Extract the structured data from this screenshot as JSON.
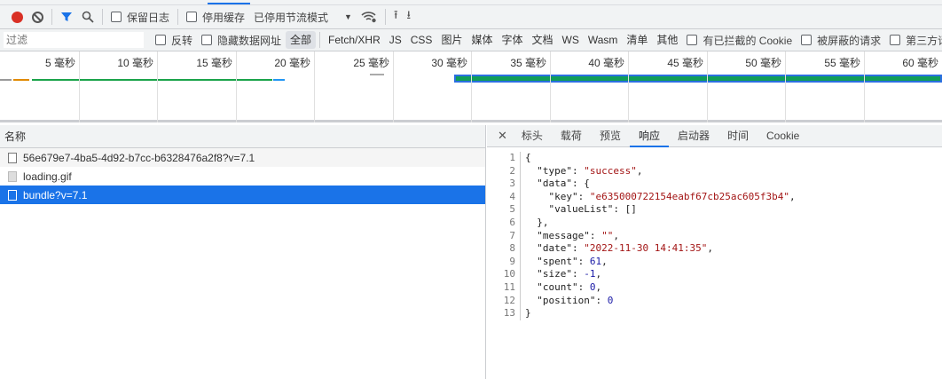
{
  "toolbar": {
    "preserve_log": "保留日志",
    "disable_cache": "停用缓存",
    "throttle": "已停用节流模式"
  },
  "filter": {
    "placeholder": "过滤",
    "invert": "反转",
    "hide_data_urls": "隐藏数据网址",
    "types": [
      "全部",
      "Fetch/XHR",
      "JS",
      "CSS",
      "图片",
      "媒体",
      "字体",
      "文档",
      "WS",
      "Wasm",
      "清单",
      "其他"
    ],
    "active_type": "全部",
    "blocked_cookies": "有已拦截的 Cookie",
    "blocked_requests": "被屏蔽的请求",
    "third_party": "第三方请求"
  },
  "timeline": {
    "ticks": [
      "5 毫秒",
      "10 毫秒",
      "15 毫秒",
      "20 毫秒",
      "25 毫秒",
      "30 毫秒",
      "35 毫秒",
      "40 毫秒",
      "45 毫秒",
      "50 毫秒",
      "55 毫秒",
      "60 毫秒"
    ]
  },
  "requests": {
    "header": "名称",
    "items": [
      {
        "name": "56e679e7-4ba5-4d92-b7cc-b6328476a2f8?v=7.1",
        "icon": "document-icon"
      },
      {
        "name": "loading.gif",
        "icon": "image-icon"
      },
      {
        "name": "bundle?v=7.1",
        "icon": "document-icon",
        "selected": true
      }
    ]
  },
  "detail": {
    "tabs": [
      "标头",
      "载荷",
      "预览",
      "响应",
      "启动器",
      "时间",
      "Cookie"
    ],
    "active_tab": "响应",
    "lines": [
      [
        [
          "p",
          "{"
        ]
      ],
      [
        [
          "p",
          "  "
        ],
        [
          "k",
          "\"type\""
        ],
        [
          "p",
          ": "
        ],
        [
          "s",
          "\"success\""
        ],
        [
          "p",
          ","
        ]
      ],
      [
        [
          "p",
          "  "
        ],
        [
          "k",
          "\"data\""
        ],
        [
          "p",
          ": {"
        ]
      ],
      [
        [
          "p",
          "    "
        ],
        [
          "k",
          "\"key\""
        ],
        [
          "p",
          ": "
        ],
        [
          "s",
          "\"e635000722154eabf67cb25ac605f3b4\""
        ],
        [
          "p",
          ","
        ]
      ],
      [
        [
          "p",
          "    "
        ],
        [
          "k",
          "\"valueList\""
        ],
        [
          "p",
          ": []"
        ]
      ],
      [
        [
          "p",
          "  },"
        ]
      ],
      [
        [
          "p",
          "  "
        ],
        [
          "k",
          "\"message\""
        ],
        [
          "p",
          ": "
        ],
        [
          "s",
          "\"\""
        ],
        [
          "p",
          ","
        ]
      ],
      [
        [
          "p",
          "  "
        ],
        [
          "k",
          "\"date\""
        ],
        [
          "p",
          ": "
        ],
        [
          "s",
          "\"2022-11-30 14:41:35\""
        ],
        [
          "p",
          ","
        ]
      ],
      [
        [
          "p",
          "  "
        ],
        [
          "k",
          "\"spent\""
        ],
        [
          "p",
          ": "
        ],
        [
          "n",
          "61"
        ],
        [
          "p",
          ","
        ]
      ],
      [
        [
          "p",
          "  "
        ],
        [
          "k",
          "\"size\""
        ],
        [
          "p",
          ": "
        ],
        [
          "n",
          "-1"
        ],
        [
          "p",
          ","
        ]
      ],
      [
        [
          "p",
          "  "
        ],
        [
          "k",
          "\"count\""
        ],
        [
          "p",
          ": "
        ],
        [
          "n",
          "0"
        ],
        [
          "p",
          ","
        ]
      ],
      [
        [
          "p",
          "  "
        ],
        [
          "k",
          "\"position\""
        ],
        [
          "p",
          ": "
        ],
        [
          "n",
          "0"
        ]
      ],
      [
        [
          "p",
          "}"
        ]
      ]
    ]
  },
  "colors": {
    "record": "#d93025",
    "accent": "#1a73e8",
    "selected_row": "#1a73e8"
  }
}
